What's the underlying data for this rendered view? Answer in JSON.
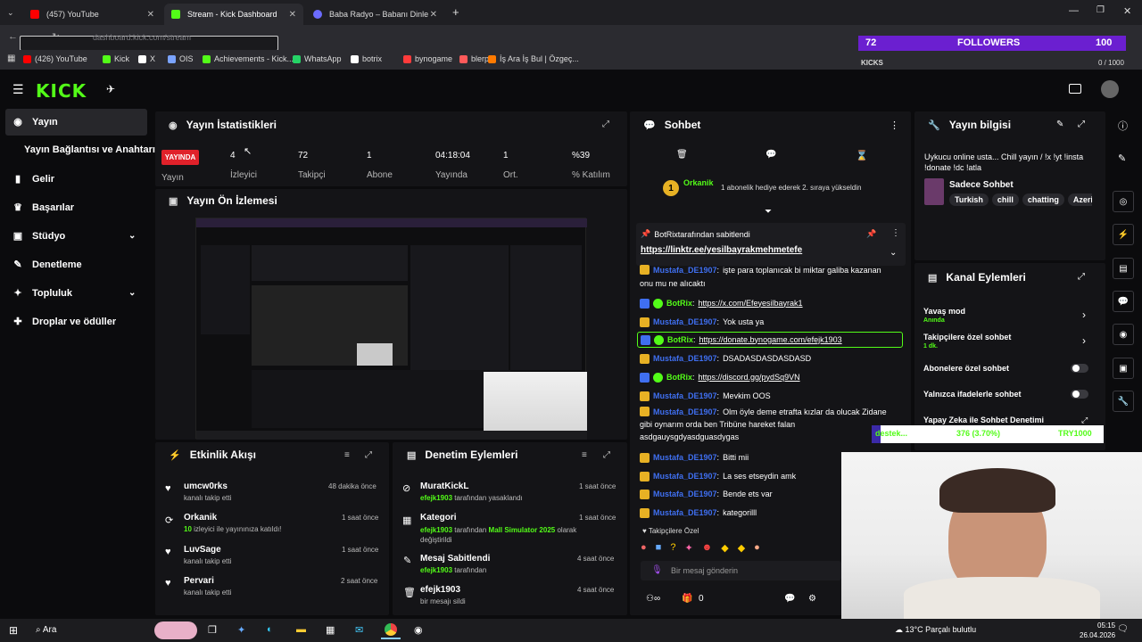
{
  "browser": {
    "tabs": [
      {
        "label": "(457) YouTube",
        "color": "#ff0000"
      },
      {
        "label": "Stream - Kick Dashboard",
        "color": "#53fc18"
      },
      {
        "label": "Baba Radyo – Babanı Dinle",
        "color": "#6b6bff"
      }
    ],
    "url": "dashboard.kick.com/stream",
    "bookmarks": [
      {
        "label": "(426) YouTube",
        "color": "#ff0000"
      },
      {
        "label": "Kick",
        "color": "#53fc18"
      },
      {
        "label": "X",
        "color": "#ffffff"
      },
      {
        "label": "OIS",
        "color": "#7aa3ff"
      },
      {
        "label": "Achievements - Kick...",
        "color": "#53fc18"
      },
      {
        "label": "WhatsApp",
        "color": "#25d366"
      },
      {
        "label": "botrix",
        "color": "#ffffff"
      },
      {
        "label": "bynogame",
        "color": "#ff3b3b"
      },
      {
        "label": "blerp",
        "color": "#ff5a5a"
      },
      {
        "label": "İş Ara İş Bul | Özgeç...",
        "color": "#ff7a00"
      }
    ]
  },
  "overlay": {
    "followers_count": "72",
    "followers_label": "FOLLOWERS",
    "followers_goal": "100",
    "kicks_label": "KICKS",
    "kicks_progress": "0 / 1000",
    "kicks_fraction": 0,
    "donation_label": "destek...",
    "donation_amount": "376 (3.70%)",
    "donation_goal": "TRY1000"
  },
  "sidebar": {
    "items": [
      {
        "label": "Yayın",
        "icon": "broadcast-icon",
        "active": true
      },
      {
        "label": "Yayın Bağlantısı ve Anahtarı",
        "icon": "",
        "active": false
      },
      {
        "label": "Gelir",
        "icon": "chart-icon",
        "active": false
      },
      {
        "label": "Başarılar",
        "icon": "trophy-icon",
        "active": false
      },
      {
        "label": "Stüdyo",
        "icon": "studio-icon",
        "active": false
      },
      {
        "label": "Denetleme",
        "icon": "wrench-icon",
        "active": false
      },
      {
        "label": "Topluluk",
        "icon": "community-icon",
        "active": false
      },
      {
        "label": "Droplar ve ödüller",
        "icon": "gift-icon",
        "active": false
      }
    ]
  },
  "stats": {
    "title": "Yayın İstatistikleri",
    "live_badge": "YAYINDA",
    "live_label": "Yayın",
    "items": [
      {
        "value": "4",
        "label": "İzleyici"
      },
      {
        "value": "72",
        "label": "Takipçi"
      },
      {
        "value": "1",
        "label": "Abone"
      },
      {
        "value": "04:18:04",
        "label": "Yayında"
      },
      {
        "value": "1",
        "label": "Ort."
      },
      {
        "value": "%39",
        "label": "% Katılım"
      }
    ]
  },
  "preview": {
    "title": "Yayın Ön İzlemesi"
  },
  "activity": {
    "title": "Etkinlik Akışı",
    "items": [
      {
        "name": "umcw0rks",
        "desc": "kanalı takip etti",
        "time": "48 dakika önce",
        "icon": "heart-icon"
      },
      {
        "name": "Orkanik",
        "desc_highlight": "10",
        "desc": "izleyici ile yayınınıza katıldı!",
        "time": "1 saat önce",
        "icon": "raid-icon"
      },
      {
        "name": "LuvSage",
        "desc": "kanalı takip etti",
        "time": "1 saat önce",
        "icon": "heart-icon"
      },
      {
        "name": "Pervari",
        "desc": "kanalı takip etti",
        "time": "2 saat önce",
        "icon": "heart-icon"
      }
    ]
  },
  "moderation": {
    "title": "Denetim Eylemleri",
    "items": [
      {
        "title": "MuratKickL",
        "user": "efejk1903",
        "desc": "tarafından yasaklandı",
        "time": "1 saat önce",
        "icon": "ban-icon"
      },
      {
        "title": "Kategori",
        "user": "efejk1903",
        "desc": "tarafından",
        "highlight": "Mall Simulator 2025",
        "desc2": "olarak değiştirildi",
        "time": "1 saat önce",
        "icon": "category-icon"
      },
      {
        "title": "Mesaj Sabitlendi",
        "user": "efejk1903",
        "desc": "tarafından",
        "time": "4 saat önce",
        "icon": "pin-icon"
      },
      {
        "title": "efejk1903",
        "desc": "bir mesajı sildi",
        "time": "4 saat önce",
        "icon": "trash-icon"
      }
    ]
  },
  "chat": {
    "title": "Sohbet",
    "gift_user": "Orkanik",
    "gift_count": "1",
    "gift_text": "1 abonelik hediye ederek 2. sıraya yükseldin",
    "pinned_user": "BotRix",
    "pinned_suffix": "tarafından sabitlendi",
    "pinned_link": "https://linktr.ee/yesilbayrakmehmetefe",
    "messages": [
      {
        "user": "Mustafa_DE1907",
        "bot": false,
        "text": "işte para toplanıcak bi miktar galiba kazanan",
        "text2": "onu mu ne alıcaktı"
      },
      {
        "user": "BotRix",
        "bot": true,
        "link": "https://x.com/Efeyesilbayrak1"
      },
      {
        "user": "Mustafa_DE1907",
        "bot": false,
        "text": "Yok usta ya"
      },
      {
        "user": "BotRix",
        "bot": true,
        "link": "https://donate.bynogame.com/efejk1903",
        "highlight": true
      },
      {
        "user": "Mustafa_DE1907",
        "bot": false,
        "text": "DSADASDASDASDASD"
      },
      {
        "user": "BotRix",
        "bot": true,
        "link": "https://discord.gg/pydSq9VN"
      },
      {
        "user": "Mustafa_DE1907",
        "bot": false,
        "text": "Mevkim OOS"
      },
      {
        "user": "Mustafa_DE1907",
        "bot": false,
        "text": "Olm öyle deme etrafta kızlar da olucak Zidane",
        "text2": "gibi oynarım orda ben Tribüne hareket falan",
        "text3": "asdgauysgdyasdguasdygas"
      },
      {
        "user": "Mustafa_DE1907",
        "bot": false,
        "text": "Bitti mii"
      },
      {
        "user": "Mustafa_DE1907",
        "bot": false,
        "text": "La ses etseydin amk"
      },
      {
        "user": "Mustafa_DE1907",
        "bot": false,
        "text": "Bende ets var"
      },
      {
        "user": "Mustafa_DE1907",
        "bot": false,
        "text": "kategorilll"
      }
    ],
    "followers_only": "Takipçilere Özel",
    "input_placeholder": "Bir mesaj gönderin",
    "points": "0"
  },
  "stream_info": {
    "title": "Yayın bilgisi",
    "stream_title": "Uykucu online usta... Chill yayın / !x !yt !insta !donate !dc !atla",
    "category": "Sadece Sohbet",
    "tags": [
      "Turkish",
      "chill",
      "chatting",
      "Azeri"
    ]
  },
  "channel_actions": {
    "title": "Kanal Eylemleri",
    "items": [
      {
        "label": "Yavaş mod",
        "sub": "Anında",
        "type": "arrow"
      },
      {
        "label": "Takipçilere özel sohbet",
        "sub": "1 dk.",
        "type": "arrow"
      },
      {
        "label": "Abonelere özel sohbet",
        "sub": "",
        "type": "toggle"
      },
      {
        "label": "Yalnızca ifadelerle sohbet",
        "sub": "",
        "type": "toggle"
      },
      {
        "label": "Yapay Zeka ile Sohbet Denetimi",
        "sub": "",
        "type": "link"
      }
    ]
  },
  "taskbar": {
    "search": "Ara",
    "weather": "13°C Parçalı bulutlu",
    "time": "05:15",
    "date": "26.04.2026"
  },
  "colors": {
    "accent": "#53fc18",
    "live": "#e0212a",
    "user": "#3f6ff0",
    "badge": "#e7b124",
    "purple": "#6b1fd0"
  }
}
